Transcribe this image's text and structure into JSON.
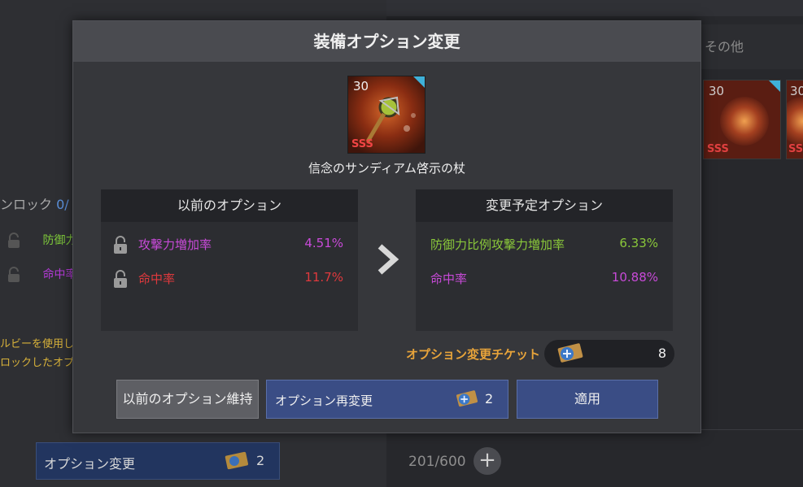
{
  "background": {
    "category_label": "その他",
    "slots": [
      {
        "level": "30",
        "grade": "SSS"
      },
      {
        "level": "30",
        "grade": "SSS"
      }
    ],
    "lock_label": "ンロック",
    "lock_count": "0/",
    "rows": [
      {
        "name": "防御力",
        "color": "#7ec83a"
      },
      {
        "name": "命中率",
        "color": "#b33ad6"
      }
    ],
    "note_lines": [
      "ルビーを使用し",
      "ロックしたオプ"
    ],
    "option_change_button": {
      "label": "オプション変更",
      "count": "2"
    },
    "inventory_capacity": "201/600",
    "plus_symbol": "+"
  },
  "modal": {
    "title": "装備オプション変更",
    "item": {
      "level": "30",
      "grade": "SSS",
      "name": "信念のサンディアム啓示の杖"
    },
    "previous": {
      "header": "以前のオプション",
      "options": [
        {
          "name": "攻撃力増加率",
          "value": "4.51%",
          "color": "#c84ad8"
        },
        {
          "name": "命中率",
          "value": "11.7%",
          "color": "#e0393d"
        }
      ]
    },
    "planned": {
      "header": "変更予定オプション",
      "options": [
        {
          "name": "防御力比例攻撃力増加率",
          "value": "6.33%",
          "color": "#8ac83a"
        },
        {
          "name": "命中率",
          "value": "10.88%",
          "color": "#c84ad8"
        }
      ]
    },
    "ticket": {
      "label": "オプション変更チケット",
      "count": "8"
    },
    "buttons": {
      "keep": "以前のオプション維持",
      "reroll": "オプション再変更",
      "reroll_count": "2",
      "apply": "適用"
    }
  }
}
